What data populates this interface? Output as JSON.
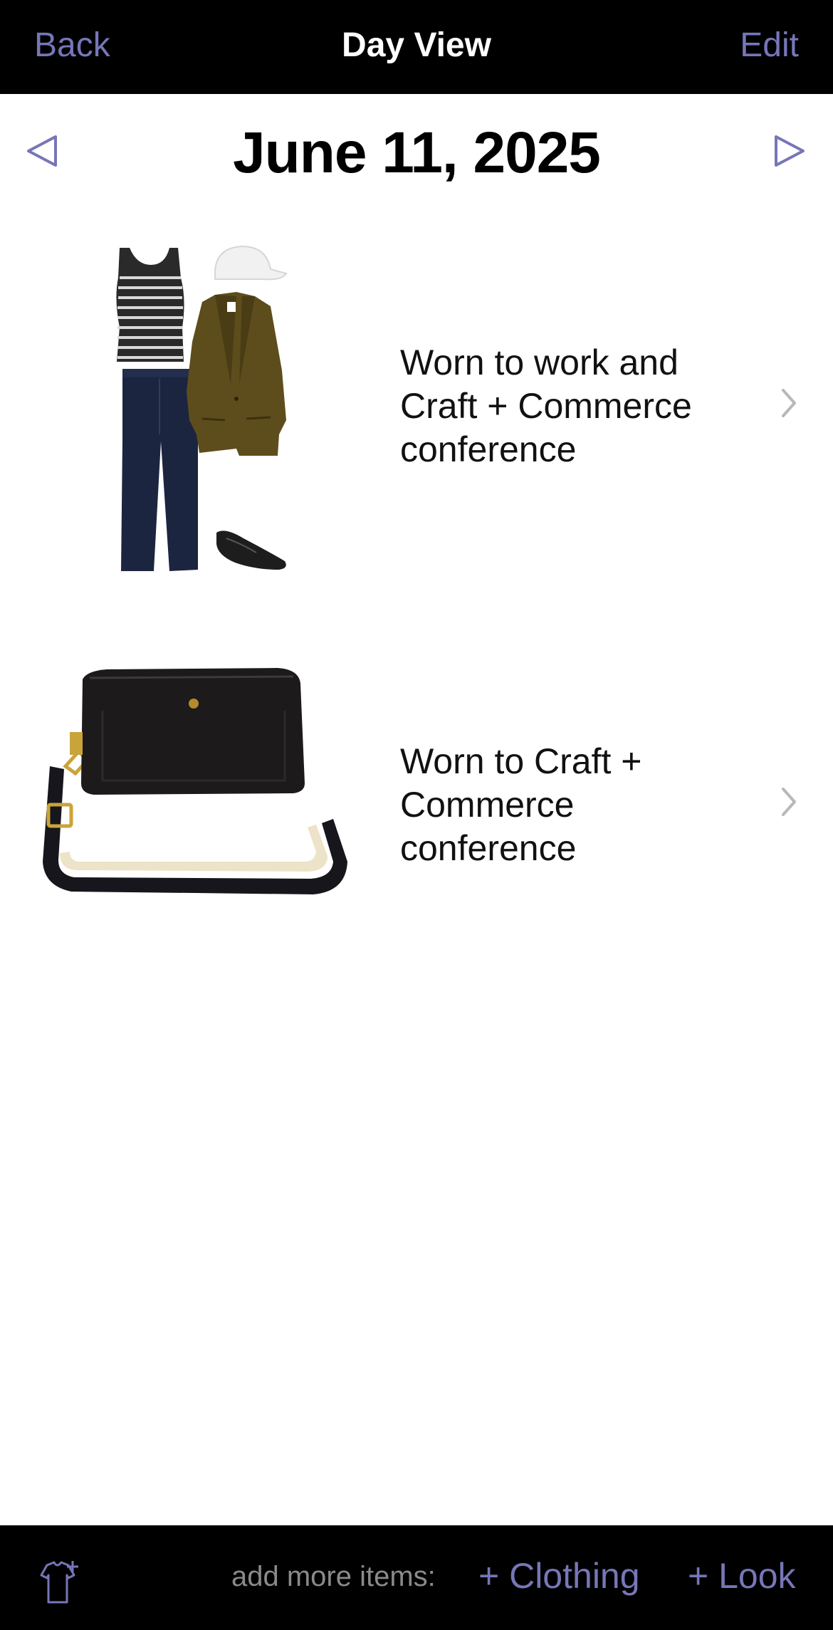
{
  "nav": {
    "back_label": "Back",
    "title": "Day View",
    "edit_label": "Edit"
  },
  "date": {
    "label": "June 11, 2025",
    "prev_icon": "triangle-left-outline-icon",
    "next_icon": "triangle-right-outline-icon"
  },
  "entries": [
    {
      "note": "Worn to work and Craft + Commerce conference",
      "image": "outfit-look-image"
    },
    {
      "note": "Worn to Craft + Commerce conference",
      "image": "black-crossbody-bag-image"
    }
  ],
  "bottom": {
    "add_label": "add more items:",
    "clothing_label": "+ Clothing",
    "look_label": "+ Look",
    "icon": "shirt-add-icon"
  },
  "colors": {
    "accent": "#7676b8",
    "bar": "#000000",
    "background": "#ffffff",
    "muted": "#8a8a8a"
  }
}
